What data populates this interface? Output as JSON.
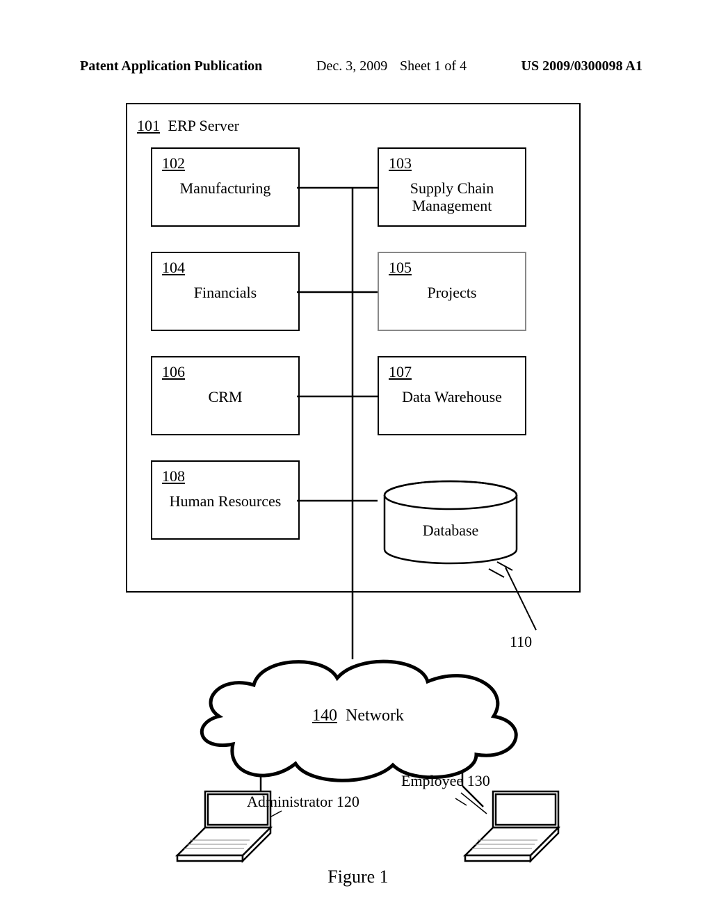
{
  "header": {
    "left": "Patent Application Publication",
    "date": "Dec. 3, 2009",
    "sheet": "Sheet 1 of 4",
    "pubno": "US 2009/0300098 A1"
  },
  "server": {
    "ref": "101",
    "title": "ERP Server"
  },
  "modules": {
    "m102": {
      "ref": "102",
      "label": "Manufacturing"
    },
    "m103": {
      "ref": "103",
      "label": "Supply Chain Management"
    },
    "m104": {
      "ref": "104",
      "label": "Financials"
    },
    "m105": {
      "ref": "105",
      "label": "Projects"
    },
    "m106": {
      "ref": "106",
      "label": "CRM"
    },
    "m107": {
      "ref": "107",
      "label": "Data Warehouse"
    },
    "m108": {
      "ref": "108",
      "label": "Human Resources"
    }
  },
  "database": {
    "label": "Database",
    "ref": "110"
  },
  "network": {
    "ref": "140",
    "label": "Network"
  },
  "actors": {
    "admin": "Administrator 120",
    "employee": "Employee 130"
  },
  "figure_caption": "Figure 1",
  "chart_data": {
    "type": "diagram",
    "title": "Figure 1",
    "nodes": [
      {
        "id": "101",
        "label": "ERP Server",
        "kind": "container"
      },
      {
        "id": "102",
        "label": "Manufacturing",
        "kind": "module",
        "parent": "101"
      },
      {
        "id": "103",
        "label": "Supply Chain Management",
        "kind": "module",
        "parent": "101"
      },
      {
        "id": "104",
        "label": "Financials",
        "kind": "module",
        "parent": "101"
      },
      {
        "id": "105",
        "label": "Projects",
        "kind": "module",
        "parent": "101"
      },
      {
        "id": "106",
        "label": "CRM",
        "kind": "module",
        "parent": "101"
      },
      {
        "id": "107",
        "label": "Data Warehouse",
        "kind": "module",
        "parent": "101"
      },
      {
        "id": "108",
        "label": "Human Resources",
        "kind": "module",
        "parent": "101"
      },
      {
        "id": "110",
        "label": "Database",
        "kind": "database",
        "parent": "101"
      },
      {
        "id": "140",
        "label": "Network",
        "kind": "network"
      },
      {
        "id": "120",
        "label": "Administrator",
        "kind": "client"
      },
      {
        "id": "130",
        "label": "Employee",
        "kind": "client"
      }
    ],
    "edges": [
      {
        "from": "102",
        "to": "103",
        "via": "bus"
      },
      {
        "from": "104",
        "to": "105",
        "via": "bus"
      },
      {
        "from": "106",
        "to": "107",
        "via": "bus"
      },
      {
        "from": "108",
        "to": "110",
        "via": "bus"
      },
      {
        "from": "101",
        "to": "140"
      },
      {
        "from": "140",
        "to": "120"
      },
      {
        "from": "140",
        "to": "130"
      }
    ]
  }
}
